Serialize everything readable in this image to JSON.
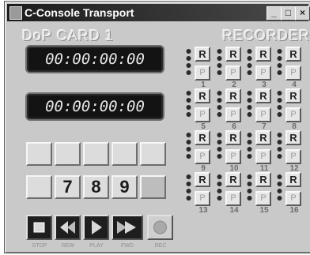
{
  "window": {
    "title": "C-Console Transport"
  },
  "titlebar": {
    "min_label": "_",
    "max_label": "□",
    "close_label": "×"
  },
  "header": {
    "left": "DoP  CARD 1",
    "right": "RECORDER"
  },
  "timecode": {
    "primary": "00:00:00:00",
    "secondary": "00:00:00:00"
  },
  "keypad": {
    "row1": [
      "",
      "",
      "",
      "",
      ""
    ],
    "row2": [
      "",
      "7",
      "8",
      "9",
      ""
    ]
  },
  "transport": {
    "labels": [
      "STOP",
      "REW",
      "PLAY",
      "FWD",
      "REC"
    ]
  },
  "tracks": {
    "record_label": "R",
    "play_label": "P",
    "numbers": [
      "1",
      "2",
      "3",
      "4",
      "5",
      "6",
      "7",
      "8",
      "9",
      "10",
      "11",
      "12",
      "13",
      "14",
      "15",
      "16"
    ]
  }
}
